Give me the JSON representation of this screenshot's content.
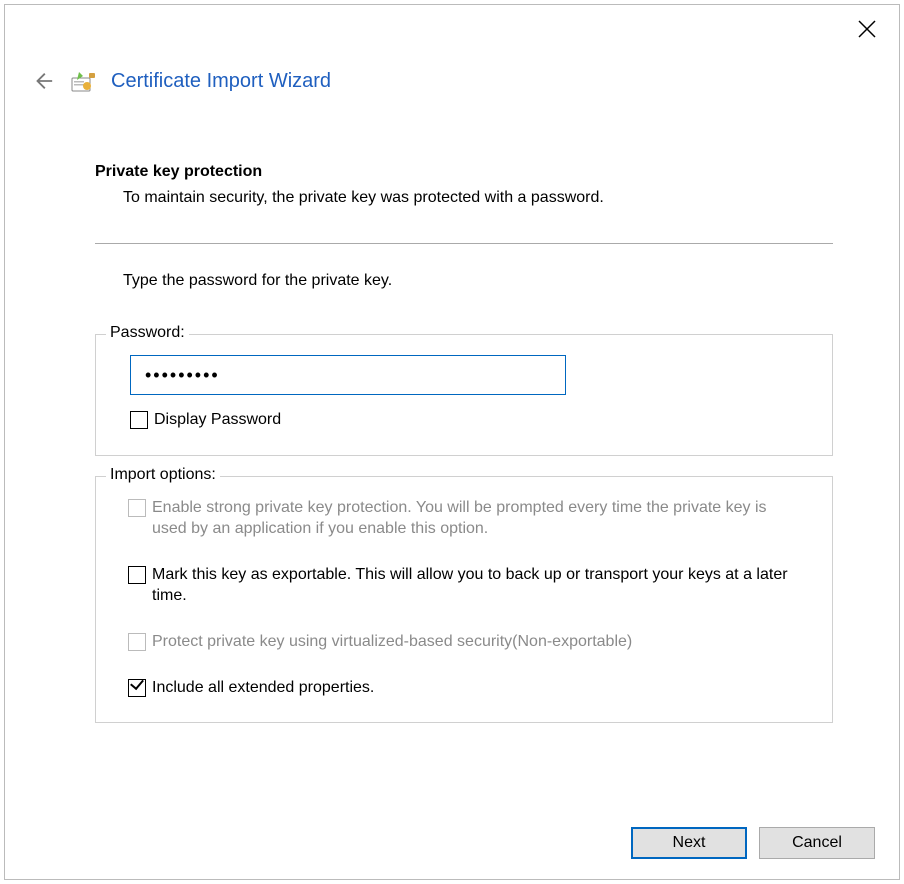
{
  "window": {
    "title": "Certificate Import Wizard"
  },
  "page": {
    "heading": "Private key protection",
    "subheading": "To maintain security, the private key was protected with a password.",
    "instruction": "Type the password for the private key."
  },
  "password": {
    "legend": "Password:",
    "value": "•••••••••",
    "display_label": "Display Password",
    "display_checked": false
  },
  "options": {
    "legend": "Import options:",
    "items": [
      {
        "label": "Enable strong private key protection. You will be prompted every time the private key is used by an application if you enable this option.",
        "checked": false,
        "enabled": false
      },
      {
        "label": "Mark this key as exportable. This will allow you to back up or transport your keys at a later time.",
        "checked": false,
        "enabled": true
      },
      {
        "label": "Protect private key using virtualized-based security(Non-exportable)",
        "checked": false,
        "enabled": false
      },
      {
        "label": "Include all extended properties.",
        "checked": true,
        "enabled": true
      }
    ]
  },
  "buttons": {
    "next": "Next",
    "cancel": "Cancel"
  }
}
